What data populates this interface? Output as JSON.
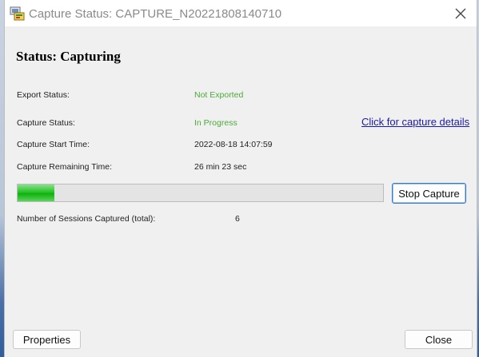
{
  "window": {
    "title": "Capture Status: CAPTURE_N20221808140710",
    "app_icon": "capture-app-icon",
    "close_icon": "close-icon"
  },
  "status": {
    "heading": "Status: Capturing"
  },
  "fields": {
    "export_status_label": "Export Status:",
    "export_status_value": "Not Exported",
    "capture_status_label": "Capture Status:",
    "capture_status_value": "In Progress",
    "start_time_label": "Capture Start Time:",
    "start_time_value": "2022-08-18 14:07:59",
    "remaining_time_label": "Capture Remaining Time:",
    "remaining_time_value": "26 min 23 sec",
    "sessions_label": "Number of Sessions Captured (total):",
    "sessions_value": "6"
  },
  "details_link": "Click for capture details",
  "progress": {
    "fraction": 0.1
  },
  "buttons": {
    "stop_capture": "Stop Capture",
    "properties": "Properties",
    "close": "Close"
  },
  "colors": {
    "status_green": "#4caa3a",
    "link_blue": "#1a1aa8",
    "progress_green": "#28c428",
    "focus_border": "#3b78c8"
  }
}
